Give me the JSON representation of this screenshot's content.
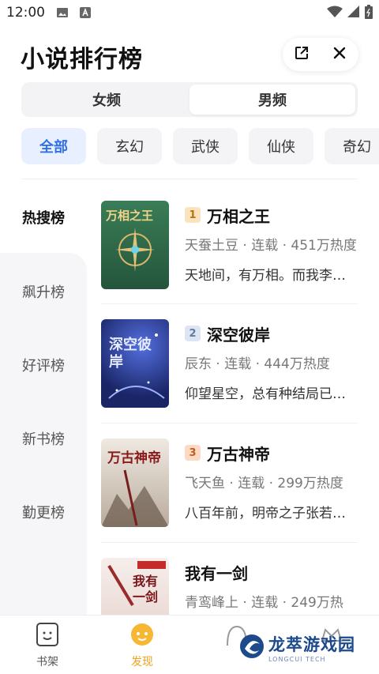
{
  "status_bar": {
    "time": "12:00"
  },
  "header": {
    "title": "小说排行榜"
  },
  "gender_tabs": [
    {
      "label": "女频",
      "active": false
    },
    {
      "label": "男频",
      "active": true
    }
  ],
  "categories": [
    {
      "label": "全部",
      "active": true
    },
    {
      "label": "玄幻",
      "active": false
    },
    {
      "label": "武侠",
      "active": false
    },
    {
      "label": "仙侠",
      "active": false
    },
    {
      "label": "奇幻",
      "active": false
    }
  ],
  "rank_nav": [
    {
      "label": "热搜榜",
      "active": true
    },
    {
      "label": "飙升榜",
      "active": false
    },
    {
      "label": "好评榜",
      "active": false
    },
    {
      "label": "新书榜",
      "active": false
    },
    {
      "label": "勤更榜",
      "active": false
    }
  ],
  "books": [
    {
      "rank": "1",
      "title": "万相之王",
      "meta": "天蚕土豆 · 连载 · 451万热度",
      "desc": "天地间，有万相。而我李…",
      "cover_text": "万相之王",
      "cover_color": "#2f6b4a"
    },
    {
      "rank": "2",
      "title": "深空彼岸",
      "meta": "辰东 · 连载 · 444万热度",
      "desc": "仰望星空，总有种结局已…",
      "cover_text": "深空彼岸",
      "cover_color": "#1d2e7a"
    },
    {
      "rank": "3",
      "title": "万古神帝",
      "meta": "飞天鱼 · 连载 · 299万热度",
      "desc": "八百年前，明帝之子张若…",
      "cover_text": "万古神帝",
      "cover_color": "#d9cfc4"
    },
    {
      "rank": "",
      "title": "我有一剑",
      "meta": "青鸾峰上 · 连载 · 249万热",
      "desc": "",
      "cover_text": "我有一剑",
      "cover_color": "#f3e6e2"
    }
  ],
  "bottom_nav": [
    {
      "label": "书架",
      "icon": "bookshelf-icon",
      "active": false
    },
    {
      "label": "发现",
      "icon": "discover-icon",
      "active": true
    }
  ],
  "watermark": {
    "text": "龙萃游戏园",
    "sub": "LONGCUI TECH"
  },
  "colors": {
    "accent": "#2f6fe8",
    "discover_active": "#f2a21b"
  }
}
